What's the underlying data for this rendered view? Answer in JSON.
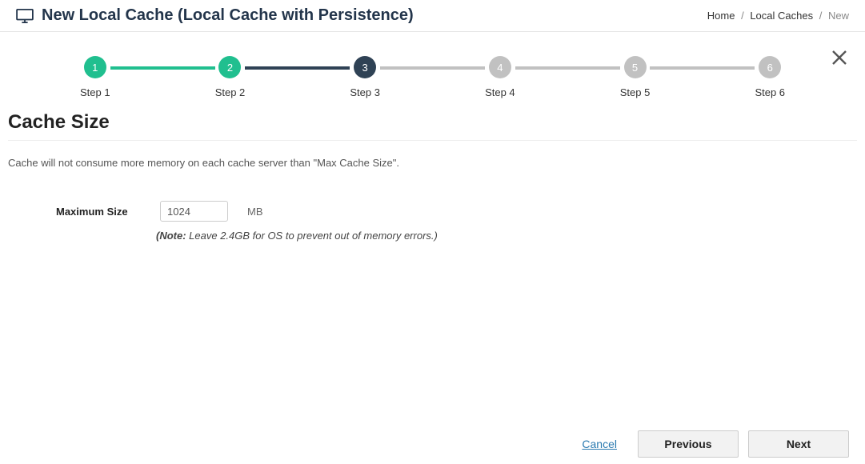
{
  "header": {
    "title": "New Local Cache (Local Cache with Persistence)"
  },
  "breadcrumb": {
    "home": "Home",
    "localCaches": "Local Caches",
    "current": "New"
  },
  "stepper": {
    "steps": [
      {
        "num": "1",
        "label": "Step 1"
      },
      {
        "num": "2",
        "label": "Step 2"
      },
      {
        "num": "3",
        "label": "Step 3"
      },
      {
        "num": "4",
        "label": "Step 4"
      },
      {
        "num": "5",
        "label": "Step 5"
      },
      {
        "num": "6",
        "label": "Step 6"
      }
    ]
  },
  "section": {
    "title": "Cache Size",
    "description": "Cache will not consume more memory on each cache server than \"Max Cache Size\"."
  },
  "form": {
    "maxSizeLabel": "Maximum Size",
    "maxSizeValue": "1024",
    "unit": "MB",
    "notePrefix": "(Note:",
    "noteText": " Leave 2.4GB for OS to prevent out of memory errors.)"
  },
  "footer": {
    "cancel": "Cancel",
    "previous": "Previous",
    "next": "Next"
  }
}
